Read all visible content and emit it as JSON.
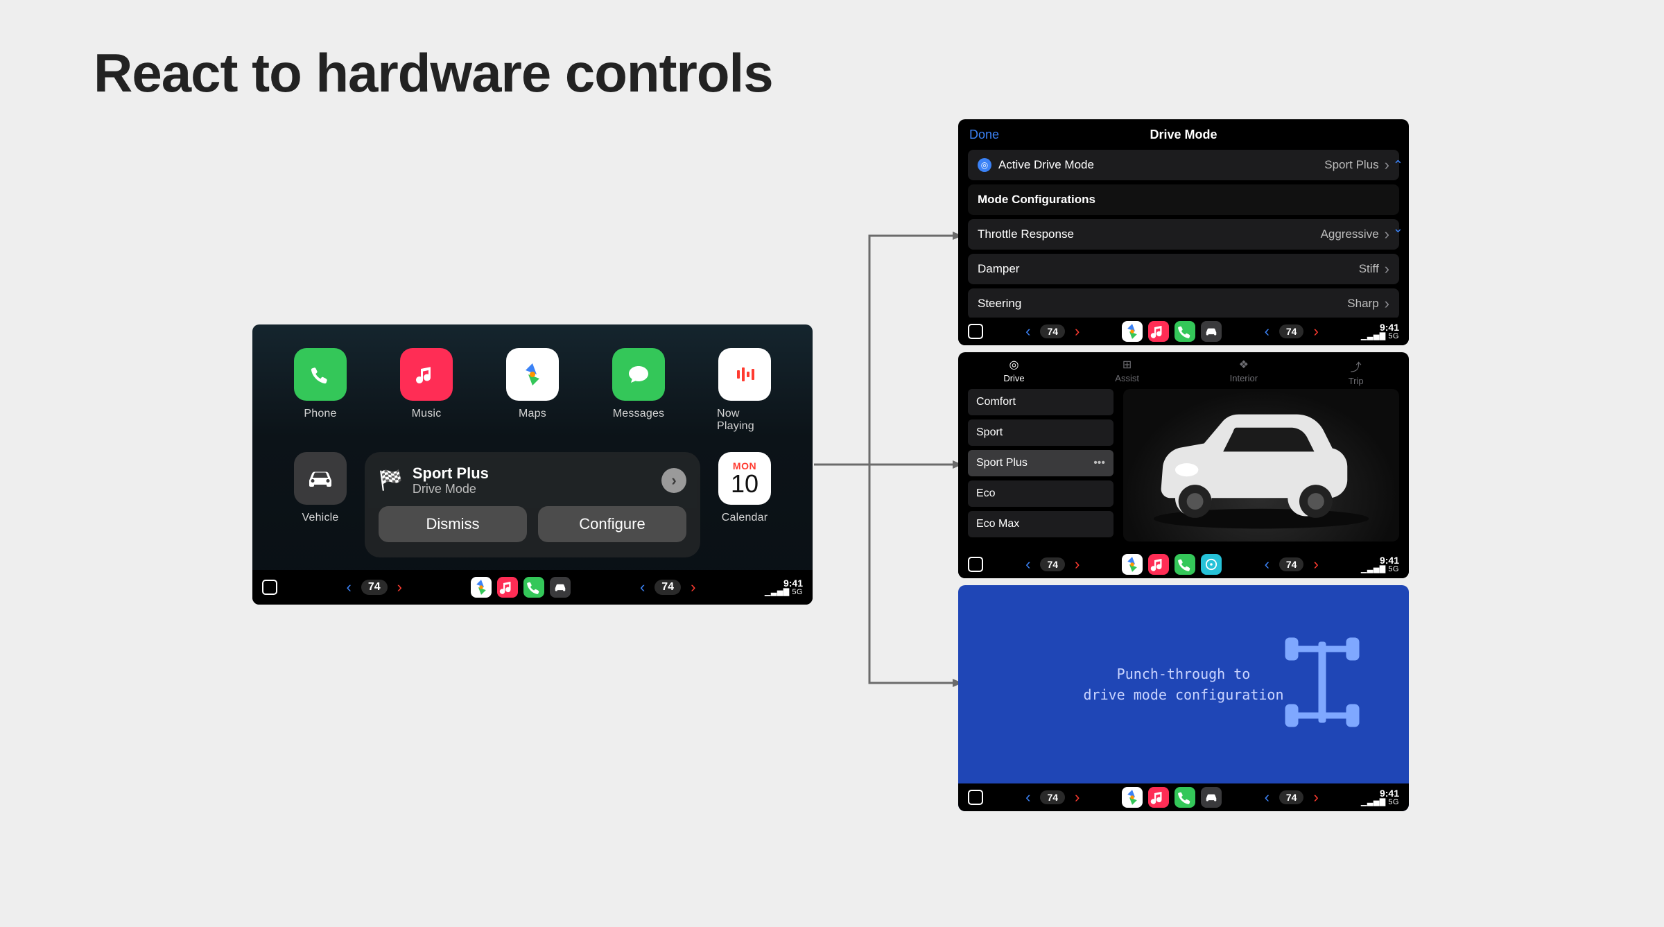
{
  "title": "React to hardware controls",
  "main": {
    "apps": [
      {
        "label": "Phone",
        "icon": "phone",
        "bg": "bg-green"
      },
      {
        "label": "Music",
        "icon": "music",
        "bg": "bg-red"
      },
      {
        "label": "Maps",
        "icon": "maps",
        "bg": "bg-white"
      },
      {
        "label": "Messages",
        "icon": "message",
        "bg": "bg-green"
      },
      {
        "label": "Now Playing",
        "icon": "nowplaying",
        "bg": "bg-white"
      }
    ],
    "vehicle_label": "Vehicle",
    "notif": {
      "title": "Sport Plus",
      "subtitle": "Drive Mode",
      "dismiss": "Dismiss",
      "configure": "Configure"
    },
    "calendar": {
      "dow": "MON",
      "day": "10",
      "label": "Calendar"
    }
  },
  "dock": {
    "temp": "74",
    "time": "9:41",
    "net": "5G"
  },
  "panel1": {
    "done": "Done",
    "title": "Drive Mode",
    "active": {
      "label": "Active Drive Mode",
      "value": "Sport Plus"
    },
    "section": "Mode Configurations",
    "rows": [
      {
        "label": "Throttle Response",
        "value": "Aggressive"
      },
      {
        "label": "Damper",
        "value": "Stiff"
      },
      {
        "label": "Steering",
        "value": "Sharp"
      }
    ]
  },
  "panel2": {
    "tabs": [
      {
        "label": "Drive",
        "active": true
      },
      {
        "label": "Assist",
        "active": false
      },
      {
        "label": "Interior",
        "active": false
      },
      {
        "label": "Trip",
        "active": false
      }
    ],
    "modes": [
      {
        "label": "Comfort",
        "sel": false
      },
      {
        "label": "Sport",
        "sel": false
      },
      {
        "label": "Sport Plus",
        "sel": true
      },
      {
        "label": "Eco",
        "sel": false
      },
      {
        "label": "Eco Max",
        "sel": false
      }
    ]
  },
  "panel3": {
    "line1": "Punch-through to",
    "line2": "drive mode configuration"
  }
}
